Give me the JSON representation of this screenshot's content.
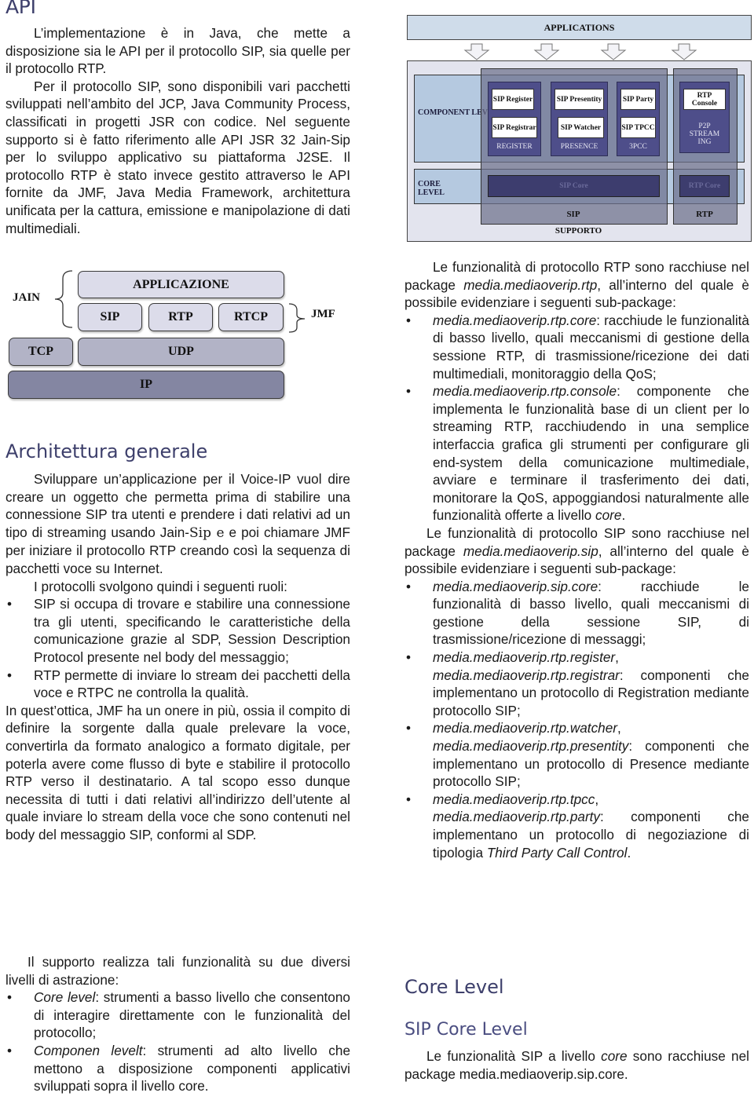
{
  "left": {
    "api_heading": "API",
    "api_paragraphs": [
      "L’implementazione è in Java, che mette a disposizione sia le API per il protocollo SIP, sia quelle per il protocollo RTP.",
      "Per il protocollo SIP, sono disponibili vari pacchetti sviluppati nell’ambito del JCP, Java Community Process, classificati in progetti JSR con codice. Nel seguente supporto si è fatto riferimento alle API JSR 32 Jain-Sip per lo sviluppo applicativo su piattaforma J2SE. Il protocollo RTP è stato invece gestito attraverso le API fornite da JMF, Java Media Framework, architettura unificata per la cattura, emissione e manipolazione di dati multimediali."
    ],
    "stack_diagram": {
      "applicazione": "APPLICAZIONE",
      "sip": "SIP",
      "rtp": "RTP",
      "rtcp": "RTCP",
      "tcp": "TCP",
      "udp": "UDP",
      "ip": "IP",
      "jain": "JAIN",
      "jmf": "JMF"
    },
    "arch_heading": "Architettura generale",
    "arch_para_1_a": "Sviluppare un’applicazione per il Voice-IP vuol dire creare un oggetto che permetta prima di stabilire una connessione SIP tra utenti e prendere i dati relativi ad un tipo di streaming usando Jain-",
    "arch_para_1_sip": "Sip",
    "arch_para_1_b": " e poi chiamare JMF per iniziare il protocollo RTP creando così la sequenza di pacchetti voce su Internet.",
    "roles_intro": "I protocolli svolgono quindi i seguenti ruoli:",
    "roles": [
      "SIP si occupa di trovare e stabilire una connessione tra gli utenti, specificando le caratteristiche della comunicazione grazie al SDP, Session Description Protocol presente nel body del messaggio;",
      "RTP permette di inviare lo stream dei pacchetti della voce e RTPC ne controlla la qualità."
    ],
    "jmf_para": "In quest’ottica, JMF ha un onere in più, ossia il compito di definire la sorgente dalla quale prelevare la voce, convertirla da formato analogico a formato digitale, per poterla avere come flusso di byte e stabilire il protocollo RTP verso il destinatario. A tal scopo esso dunque necessita di tutti i dati relativi all’indirizzo dell’utente al quale inviare lo stream della voce che sono contenuti nel body del messaggio SIP, conformi al SDP.",
    "support_para": "Il supporto realizza tali funzionalità su due diversi livelli di astrazione:",
    "levels": [
      {
        "term": "Core level",
        "text": ": strumenti a basso livello che consentono di interagire direttamente con le funzionalità del protocollo;"
      },
      {
        "term": "Componen levelt",
        "text": ": strumenti ad alto livello che mettono a disposizione componenti applicativi sviluppati sopra il livello core."
      }
    ],
    "bullet": "•"
  },
  "right": {
    "arch_diagram": {
      "applications": "APPLICATIONS",
      "component_level": "COMPONENT LEVEL",
      "core_level": "CORE LEVEL",
      "groups": [
        {
          "label": "REGISTER",
          "components": [
            "SIP Register",
            "SIP Registrar"
          ]
        },
        {
          "label": "PRESENCE",
          "components": [
            "SIP Presentity",
            "SIP Watcher"
          ]
        },
        {
          "label": "3PCC",
          "components": [
            "SIP Party",
            "SIP TPCC"
          ]
        },
        {
          "label": "P2P STREAM ING",
          "components": [
            "RTP Console"
          ]
        }
      ],
      "sip_core": "SIP Core",
      "rtp_core": "RTP Core",
      "sip": "SIP",
      "rtp": "RTP",
      "supporto": "SUPPORTO"
    },
    "rtp_intro_a": "Le funzionalità di protocollo RTP sono racchiuse nel package ",
    "rtp_intro_pkg": "media.mediaoverip.rtp",
    "rtp_intro_b": ", all’interno del quale è possibile evidenziare i seguenti sub-package:",
    "rtp_items": [
      {
        "pkg": "media.mediaoverip.rtp.core",
        "text": ": racchiude le funzionalità di basso livello, quali meccanismi di gestione della sessione RTP, di trasmissione/ricezione dei dati multimediali, monitoraggio della QoS;"
      },
      {
        "pkg": "media.mediaoverip.rtp.console",
        "text": ": componente che implementa le funzionalità base di un client per lo streaming RTP, racchiudendo in una semplice interfaccia grafica gli strumenti per configurare gli end-system della comunicazione multimediale, avviare e terminare il trasferimento dei dati, monitorare la QoS, appoggiandosi naturalmente alle funzionalità offerte a livello ",
        "tail_italic": "core",
        "tail": "."
      }
    ],
    "sip_intro_a": "Le funzionalità di protocollo SIP sono racchiuse nel package ",
    "sip_intro_pkg": "media.mediaoverip.sip",
    "sip_intro_b": ", all’interno del quale è possibile evidenziare i seguenti sub-package:",
    "sip_items": [
      {
        "pkg": "media.mediaoverip.sip.core",
        "text": ": racchiude le funzionalità di basso livello, quali meccanismi di gestione della sessione SIP, di trasmissione/ricezione di messaggi;"
      },
      {
        "pkg": "media.mediaoverip.rtp.register",
        "pkg2": "media.mediaoverip.rtp.registrar",
        "text": ": componenti che implementano un protocollo di Registration mediante protocollo SIP;"
      },
      {
        "pkg": "media.mediaoverip.rtp.watcher",
        "pkg2": "media.mediaoverip.rtp.presentity",
        "text": ": componenti che implementano un protocollo di Presence mediante protocollo SIP;"
      },
      {
        "pkg": "media.mediaoverip.rtp.tpcc",
        "pkg2": "media.mediaoverip.rtp.party",
        "text": ": componenti che implementano un protocollo di negoziazione di tipologia ",
        "tail_italic": "Third Party Call Control",
        "tail": "."
      }
    ],
    "core_level_heading": "Core Level",
    "sip_core_heading": "SIP Core Level",
    "sip_core_para_a": "Le funzionalità SIP a livello ",
    "sip_core_para_it": "core",
    "sip_core_para_b": " sono racchiuse nel package media.mediaoverip.sip.core.",
    "bullet": "•"
  }
}
